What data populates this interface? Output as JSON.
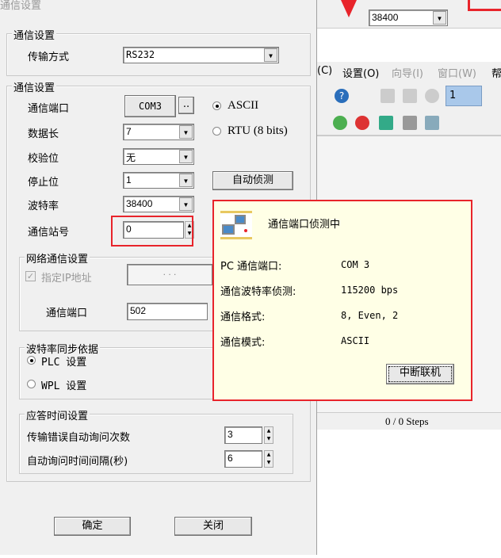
{
  "dialog": {
    "title": "通信设置",
    "group1": {
      "label": "通信设置",
      "transfer_label": "传输方式",
      "transfer_value": "RS232"
    },
    "group2": {
      "label": "通信设置",
      "port_label": "通信端口",
      "port_value": "COM3",
      "browse": "..",
      "ascii": "ASCII",
      "rtu": "RTU (8 bits)",
      "data_len_label": "数据长",
      "data_len": "7",
      "parity_label": "校验位",
      "parity": "无",
      "stop_label": "停止位",
      "stop": "1",
      "auto_detect": "自动侦测",
      "baud_label": "波特率",
      "baud": "38400",
      "station_label": "通信站号",
      "station": "0"
    },
    "network": {
      "label": "网络通信设置",
      "ip_label": "指定IP地址",
      "ip_checked": true,
      "ip_value": ".   .   .",
      "port_label": "通信端口",
      "port_value": "502"
    },
    "baud_sync": {
      "label": "波特率同步依据",
      "plc": "PLC 设置",
      "wpl": "WPL 设置",
      "selected": "plc"
    },
    "response": {
      "label": "应答时间设置",
      "retry_label": "传输错误自动询问次数",
      "retry": "3",
      "interval_label": "自动询问时间间隔(秒)",
      "interval": "6"
    },
    "ok": "确定",
    "close": "关闭"
  },
  "popup": {
    "title": "通信端口侦测中",
    "rows": [
      {
        "label": "PC 通信端口:",
        "value": "COM 3"
      },
      {
        "label": "通信波特率侦测:",
        "value": "115200 bps"
      },
      {
        "label": "通信格式:",
        "value": "8, Even, 2"
      },
      {
        "label": "通信模式:",
        "value": "ASCII"
      }
    ],
    "abort": "中断联机"
  },
  "app": {
    "baud": "38400",
    "menu": [
      "(C)",
      "设置(O)",
      "向导(I)",
      "窗口(W)",
      "帮"
    ],
    "toolbar_value": "1",
    "status": "0 / 0 Steps"
  },
  "colors": {
    "highlight": "#e8242b",
    "popup_bg": "#ffffe6"
  }
}
